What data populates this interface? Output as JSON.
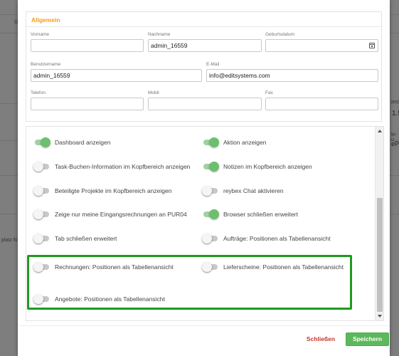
{
  "background": {
    "left_texts": [
      "O",
      "platz für"
    ],
    "right_texts": [
      "iens",
      "1.5",
      "te- u",
      "ePr"
    ]
  },
  "general": {
    "title": "Allgemein",
    "fields": {
      "vorname": {
        "label": "Vorname",
        "value": ""
      },
      "nachname": {
        "label": "Nachname",
        "value": "admin_16559"
      },
      "geburtsdatum": {
        "label": "Geburtsdatum",
        "value": ""
      },
      "benutzername": {
        "label": "Benutzername",
        "value": "admin_16559"
      },
      "email": {
        "label": "E-Mail",
        "value": "info@editsystems.com"
      },
      "telefon": {
        "label": "Telefon",
        "value": ""
      },
      "mobil": {
        "label": "Mobil",
        "value": ""
      },
      "fax": {
        "label": "Fax",
        "value": ""
      }
    }
  },
  "toggles": [
    {
      "label": "Dashboard anzeigen",
      "on": true
    },
    {
      "label": "Aktion anzeigen",
      "on": true
    },
    {
      "label": "Task-Buchen-Information im Kopfbereich anzeigen",
      "on": false
    },
    {
      "label": "Notizen im Kopfbereich anzeigen",
      "on": true
    },
    {
      "label": "Beteiligte Projekte im Kopfbereich anzeigen",
      "on": false
    },
    {
      "label": "reybex Chat aktivieren",
      "on": false
    },
    {
      "label": "Zeige nur meine Eingangsrechnungen an PUR04",
      "on": false
    },
    {
      "label": "Browser schließen erweitert",
      "on": true
    },
    {
      "label": "Tab schließen erweitert",
      "on": false
    },
    {
      "label": "Aufträge: Positionen als Tabellenansicht",
      "on": false
    },
    {
      "label": "Rechnungen: Positionen als Tabellenansicht",
      "on": false
    },
    {
      "label": "Lieferscheine: Positionen als Tabellenansicht",
      "on": false
    },
    {
      "label": "Angebote: Positionen als Tabellenansicht",
      "on": false
    }
  ],
  "colors": {
    "toggle_on": "#6dbf6f",
    "highlight": "#1e9a1e",
    "close": "#c0392b",
    "save": "#5cb85c",
    "section_title": "#f39c12"
  },
  "footer": {
    "close_label": "Schließen",
    "save_label": "Speichern"
  }
}
